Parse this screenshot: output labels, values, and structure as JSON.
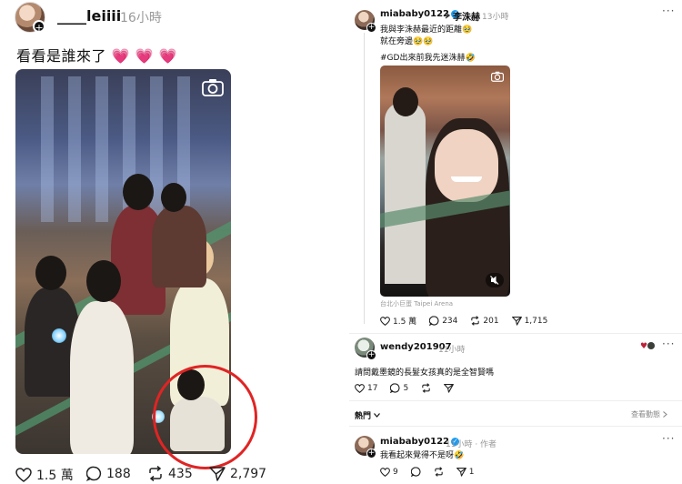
{
  "left_post": {
    "username": "____leiiii",
    "time": "16小時",
    "caption": "看看是誰來了",
    "caption_emoji": "💗 💗 💗",
    "actions": {
      "likes": "1.5 萬",
      "comments": "188",
      "reposts": "435",
      "shares": "2,797"
    }
  },
  "right_thread": {
    "post": {
      "username": "miababy0122",
      "mention": "李洙赫",
      "time": "13小時",
      "line1": "我與李洙赫最近的距離🥹",
      "line2": "就在旁邊🥹🥹",
      "line3": "#GD出來前我先迷洙赫🤣",
      "location": "台北小巨蛋 Taipei Arena",
      "actions": {
        "likes": "1.5 萬",
        "comments": "234",
        "reposts": "201",
        "shares": "1,715"
      }
    },
    "reply1": {
      "username": "wendy201907",
      "time": "11小時",
      "text": "請問戴墨鏡的長髮女孩真的是全智賢嗎",
      "actions": {
        "likes": "17",
        "comments": "5"
      }
    },
    "popular_label": "熱門",
    "view_activity": "查看動態",
    "reply2": {
      "username": "miababy0122",
      "time": "11小時",
      "author_label": "作者",
      "text": "我看起來覺得不是呀🤣",
      "actions": {
        "likes": "9",
        "shares": "1"
      }
    }
  },
  "colors": {
    "heart": "#e8336a",
    "red_ring": "#e02424",
    "verified": "#1d9bf0"
  }
}
